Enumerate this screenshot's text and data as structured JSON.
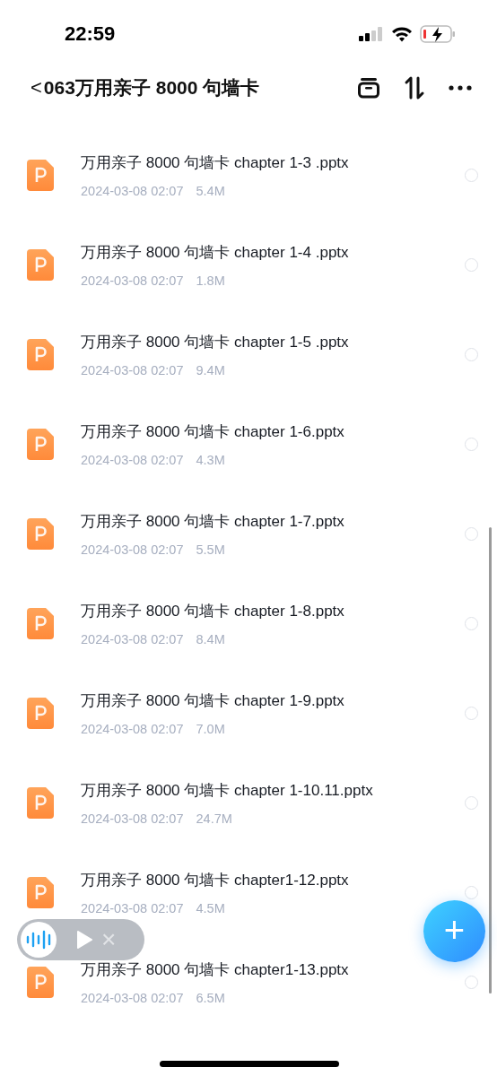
{
  "status_bar": {
    "time": "22:59"
  },
  "nav": {
    "back": "<",
    "title": "063万用亲子 8000 句墙卡"
  },
  "files": [
    {
      "name": "万用亲子 8000 句墙卡 chapter 1-3 .pptx",
      "date": "2024-03-08 02:07",
      "size": "5.4M",
      "selected": false
    },
    {
      "name": "万用亲子 8000 句墙卡 chapter 1-4 .pptx",
      "date": "2024-03-08 02:07",
      "size": "1.8M",
      "selected": false
    },
    {
      "name": "万用亲子 8000 句墙卡 chapter 1-5 .pptx",
      "date": "2024-03-08 02:07",
      "size": "9.4M",
      "selected": false
    },
    {
      "name": "万用亲子 8000 句墙卡 chapter 1-6.pptx",
      "date": "2024-03-08 02:07",
      "size": "4.3M",
      "selected": false
    },
    {
      "name": "万用亲子 8000 句墙卡 chapter 1-7.pptx",
      "date": "2024-03-08 02:07",
      "size": "5.5M",
      "selected": false
    },
    {
      "name": "万用亲子 8000 句墙卡 chapter 1-8.pptx",
      "date": "2024-03-08 02:07",
      "size": "8.4M",
      "selected": false
    },
    {
      "name": "万用亲子 8000 句墙卡 chapter 1-9.pptx",
      "date": "2024-03-08 02:07",
      "size": "7.0M",
      "selected": false
    },
    {
      "name": "万用亲子 8000 句墙卡 chapter 1-10.11.pptx",
      "date": "2024-03-08 02:07",
      "size": "24.7M",
      "selected": false
    },
    {
      "name": "万用亲子 8000 句墙卡 chapter1-12.pptx",
      "date": "2024-03-08 02:07",
      "size": "4.5M",
      "selected": false
    },
    {
      "name": "万用亲子 8000 句墙卡 chapter1-13.pptx",
      "date": "2024-03-08 02:07",
      "size": "6.5M",
      "selected": false
    }
  ],
  "voice_player": {
    "close": "×"
  },
  "fab": {
    "label": "+"
  }
}
